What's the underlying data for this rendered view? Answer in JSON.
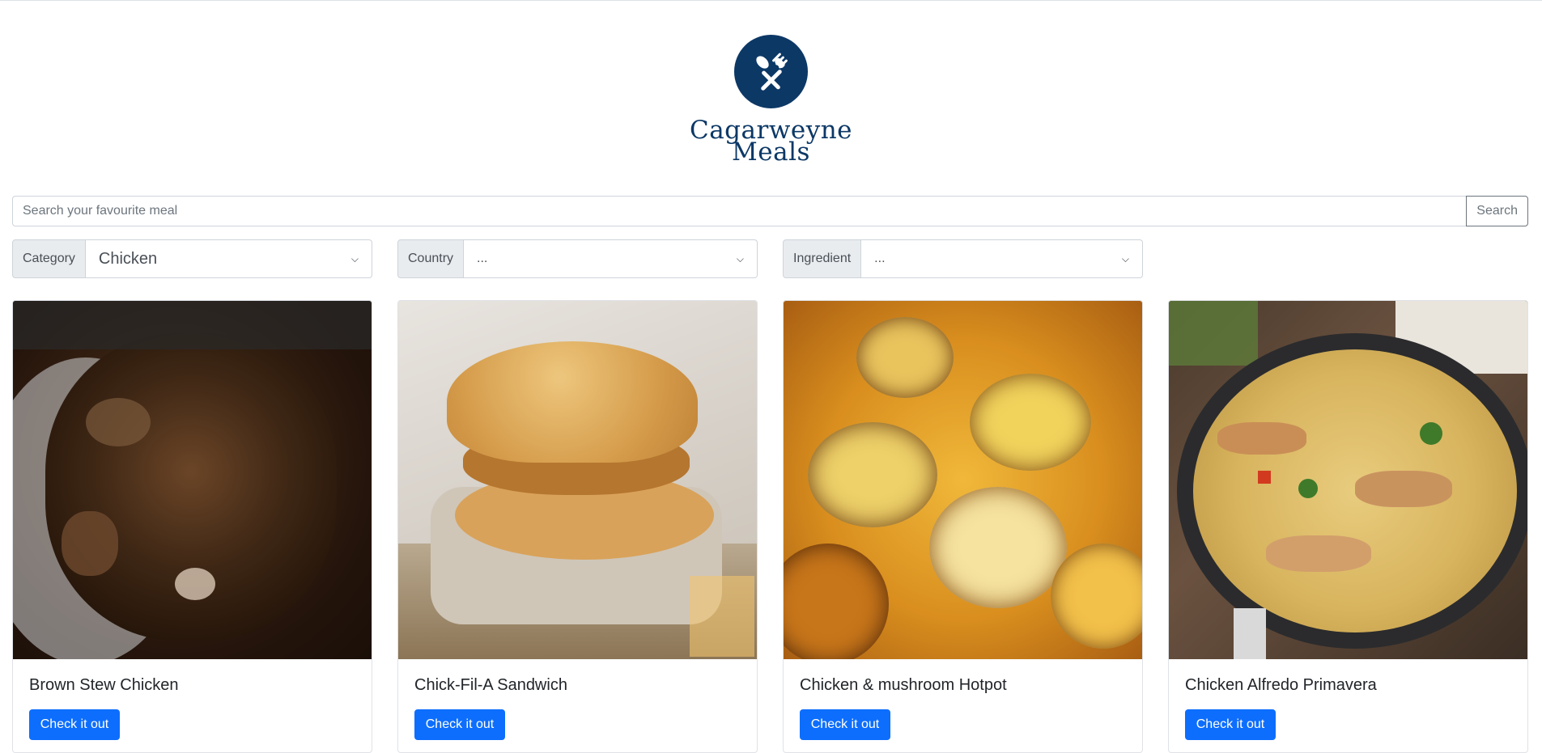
{
  "brand": {
    "name": "Cagarweyne Meals",
    "line1": "Cagarweyne",
    "line2": "Meals",
    "color": "#0c3866"
  },
  "search": {
    "placeholder": "Search your favourite meal",
    "value": "",
    "button_label": "Search"
  },
  "filters": [
    {
      "label": "Category",
      "selected": "Chicken"
    },
    {
      "label": "Country",
      "selected": "..."
    },
    {
      "label": "Ingredient",
      "selected": "..."
    }
  ],
  "meals": [
    {
      "title": "Brown Stew Chicken",
      "image": "brown-stew-chicken-photo",
      "button": "Check it out"
    },
    {
      "title": "Chick-Fil-A Sandwich",
      "image": "chicken-sandwich-photo",
      "button": "Check it out"
    },
    {
      "title": "Chicken & mushroom Hotpot",
      "image": "chicken-hotpot-photo",
      "button": "Check it out"
    },
    {
      "title": "Chicken Alfredo Primavera",
      "image": "chicken-alfredo-pasta-photo",
      "button": "Check it out"
    }
  ],
  "colors": {
    "primary": "#0d6efd",
    "brand": "#0c3866",
    "border": "#ced4da"
  }
}
